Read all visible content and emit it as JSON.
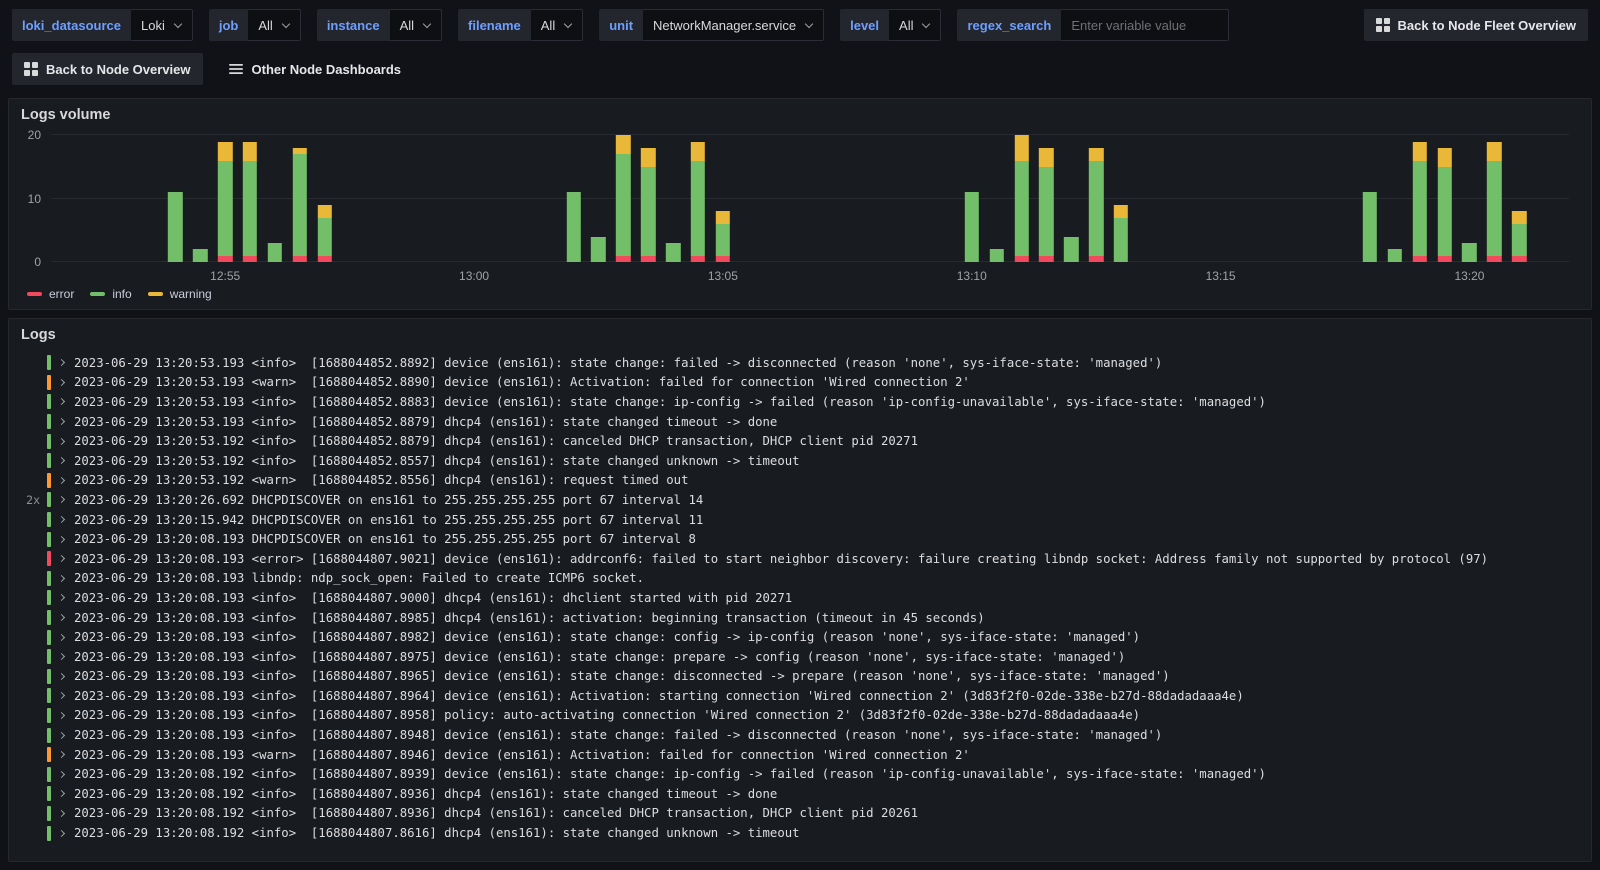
{
  "toolbar": {
    "variables": [
      {
        "label": "loki_datasource",
        "type": "select",
        "value": "Loki"
      },
      {
        "label": "job",
        "type": "select",
        "value": "All"
      },
      {
        "label": "instance",
        "type": "select",
        "value": "All"
      },
      {
        "label": "filename",
        "type": "select",
        "value": "All"
      },
      {
        "label": "unit",
        "type": "select",
        "value": "NetworkManager.service"
      },
      {
        "label": "level",
        "type": "select",
        "value": "All"
      },
      {
        "label": "regex_search",
        "type": "input",
        "placeholder": "Enter variable value"
      }
    ],
    "fleet_button": {
      "label": "Back to Node Fleet Overview"
    }
  },
  "nav": {
    "back_button": {
      "label": "Back to Node Overview"
    },
    "other_dashboards": {
      "label": "Other Node Dashboards"
    }
  },
  "chart_data": {
    "type": "bar",
    "stacked": true,
    "title": "Logs volume",
    "x_axis": {
      "start": "12:51:30",
      "end": "13:22:00",
      "tick_labels": [
        "12:55",
        "13:00",
        "13:05",
        "13:10",
        "13:15",
        "13:20"
      ]
    },
    "y_axis": {
      "tick_labels": [
        0,
        10,
        20
      ],
      "max": 21
    },
    "legend_position": "bottom",
    "legend": [
      {
        "label": "error",
        "color": "#f2495c"
      },
      {
        "label": "info",
        "color": "#73bf69"
      },
      {
        "label": "warning",
        "color": "#eab839"
      }
    ],
    "bars": [
      {
        "t": "12:54:00",
        "error": 0,
        "info": 11,
        "warning": 0
      },
      {
        "t": "12:54:30",
        "error": 0,
        "info": 2,
        "warning": 0
      },
      {
        "t": "12:55:00",
        "error": 1,
        "info": 15,
        "warning": 3
      },
      {
        "t": "12:55:30",
        "error": 1,
        "info": 15,
        "warning": 3
      },
      {
        "t": "12:56:00",
        "error": 0,
        "info": 3,
        "warning": 0
      },
      {
        "t": "12:56:30",
        "error": 1,
        "info": 16,
        "warning": 1
      },
      {
        "t": "12:57:00",
        "error": 1,
        "info": 6,
        "warning": 2
      },
      {
        "t": "13:02:00",
        "error": 0,
        "info": 11,
        "warning": 0
      },
      {
        "t": "13:02:30",
        "error": 0,
        "info": 4,
        "warning": 0
      },
      {
        "t": "13:03:00",
        "error": 1,
        "info": 16,
        "warning": 3
      },
      {
        "t": "13:03:30",
        "error": 1,
        "info": 14,
        "warning": 3
      },
      {
        "t": "13:04:00",
        "error": 0,
        "info": 3,
        "warning": 0
      },
      {
        "t": "13:04:30",
        "error": 1,
        "info": 15,
        "warning": 3
      },
      {
        "t": "13:05:00",
        "error": 1,
        "info": 5,
        "warning": 2
      },
      {
        "t": "13:10:00",
        "error": 0,
        "info": 11,
        "warning": 0
      },
      {
        "t": "13:10:30",
        "error": 0,
        "info": 2,
        "warning": 0
      },
      {
        "t": "13:11:00",
        "error": 1,
        "info": 15,
        "warning": 4
      },
      {
        "t": "13:11:30",
        "error": 1,
        "info": 14,
        "warning": 3
      },
      {
        "t": "13:12:00",
        "error": 0,
        "info": 4,
        "warning": 0
      },
      {
        "t": "13:12:30",
        "error": 1,
        "info": 15,
        "warning": 2
      },
      {
        "t": "13:13:00",
        "error": 0,
        "info": 7,
        "warning": 2
      },
      {
        "t": "13:18:00",
        "error": 0,
        "info": 11,
        "warning": 0
      },
      {
        "t": "13:18:30",
        "error": 0,
        "info": 2,
        "warning": 0
      },
      {
        "t": "13:19:00",
        "error": 1,
        "info": 15,
        "warning": 3
      },
      {
        "t": "13:19:30",
        "error": 1,
        "info": 14,
        "warning": 3
      },
      {
        "t": "13:20:00",
        "error": 0,
        "info": 3,
        "warning": 0
      },
      {
        "t": "13:20:30",
        "error": 1,
        "info": 15,
        "warning": 3
      },
      {
        "t": "13:21:00",
        "error": 1,
        "info": 5,
        "warning": 2
      }
    ]
  },
  "logs": {
    "title": "Logs",
    "level_colors": {
      "info": "#73bf69",
      "warn": "#ff9830",
      "error": "#f2495c"
    },
    "lines": [
      {
        "count": "",
        "level": "info",
        "text": "2023-06-29 13:20:53.193 <info>  [1688044852.8892] device (ens161): state change: failed -> disconnected (reason 'none', sys-iface-state: 'managed')"
      },
      {
        "count": "",
        "level": "warn",
        "text": "2023-06-29 13:20:53.193 <warn>  [1688044852.8890] device (ens161): Activation: failed for connection 'Wired connection 2'"
      },
      {
        "count": "",
        "level": "info",
        "text": "2023-06-29 13:20:53.193 <info>  [1688044852.8883] device (ens161): state change: ip-config -> failed (reason 'ip-config-unavailable', sys-iface-state: 'managed')"
      },
      {
        "count": "",
        "level": "info",
        "text": "2023-06-29 13:20:53.193 <info>  [1688044852.8879] dhcp4 (ens161): state changed timeout -> done"
      },
      {
        "count": "",
        "level": "info",
        "text": "2023-06-29 13:20:53.192 <info>  [1688044852.8879] dhcp4 (ens161): canceled DHCP transaction, DHCP client pid 20271"
      },
      {
        "count": "",
        "level": "info",
        "text": "2023-06-29 13:20:53.192 <info>  [1688044852.8557] dhcp4 (ens161): state changed unknown -> timeout"
      },
      {
        "count": "",
        "level": "warn",
        "text": "2023-06-29 13:20:53.192 <warn>  [1688044852.8556] dhcp4 (ens161): request timed out"
      },
      {
        "count": "2x",
        "level": "info",
        "text": "2023-06-29 13:20:26.692 DHCPDISCOVER on ens161 to 255.255.255.255 port 67 interval 14"
      },
      {
        "count": "",
        "level": "info",
        "text": "2023-06-29 13:20:15.942 DHCPDISCOVER on ens161 to 255.255.255.255 port 67 interval 11"
      },
      {
        "count": "",
        "level": "info",
        "text": "2023-06-29 13:20:08.193 DHCPDISCOVER on ens161 to 255.255.255.255 port 67 interval 8"
      },
      {
        "count": "",
        "level": "error",
        "text": "2023-06-29 13:20:08.193 <error> [1688044807.9021] device (ens161): addrconf6: failed to start neighbor discovery: failure creating libndp socket: Address family not supported by protocol (97)"
      },
      {
        "count": "",
        "level": "info",
        "text": "2023-06-29 13:20:08.193 libndp: ndp_sock_open: Failed to create ICMP6 socket."
      },
      {
        "count": "",
        "level": "info",
        "text": "2023-06-29 13:20:08.193 <info>  [1688044807.9000] dhcp4 (ens161): dhclient started with pid 20271"
      },
      {
        "count": "",
        "level": "info",
        "text": "2023-06-29 13:20:08.193 <info>  [1688044807.8985] dhcp4 (ens161): activation: beginning transaction (timeout in 45 seconds)"
      },
      {
        "count": "",
        "level": "info",
        "text": "2023-06-29 13:20:08.193 <info>  [1688044807.8982] device (ens161): state change: config -> ip-config (reason 'none', sys-iface-state: 'managed')"
      },
      {
        "count": "",
        "level": "info",
        "text": "2023-06-29 13:20:08.193 <info>  [1688044807.8975] device (ens161): state change: prepare -> config (reason 'none', sys-iface-state: 'managed')"
      },
      {
        "count": "",
        "level": "info",
        "text": "2023-06-29 13:20:08.193 <info>  [1688044807.8965] device (ens161): state change: disconnected -> prepare (reason 'none', sys-iface-state: 'managed')"
      },
      {
        "count": "",
        "level": "info",
        "text": "2023-06-29 13:20:08.193 <info>  [1688044807.8964] device (ens161): Activation: starting connection 'Wired connection 2' (3d83f2f0-02de-338e-b27d-88dadadaaa4e)"
      },
      {
        "count": "",
        "level": "info",
        "text": "2023-06-29 13:20:08.193 <info>  [1688044807.8958] policy: auto-activating connection 'Wired connection 2' (3d83f2f0-02de-338e-b27d-88dadadaaa4e)"
      },
      {
        "count": "",
        "level": "info",
        "text": "2023-06-29 13:20:08.193 <info>  [1688044807.8948] device (ens161): state change: failed -> disconnected (reason 'none', sys-iface-state: 'managed')"
      },
      {
        "count": "",
        "level": "warn",
        "text": "2023-06-29 13:20:08.193 <warn>  [1688044807.8946] device (ens161): Activation: failed for connection 'Wired connection 2'"
      },
      {
        "count": "",
        "level": "info",
        "text": "2023-06-29 13:20:08.192 <info>  [1688044807.8939] device (ens161): state change: ip-config -> failed (reason 'ip-config-unavailable', sys-iface-state: 'managed')"
      },
      {
        "count": "",
        "level": "info",
        "text": "2023-06-29 13:20:08.192 <info>  [1688044807.8936] dhcp4 (ens161): state changed timeout -> done"
      },
      {
        "count": "",
        "level": "info",
        "text": "2023-06-29 13:20:08.192 <info>  [1688044807.8936] dhcp4 (ens161): canceled DHCP transaction, DHCP client pid 20261"
      },
      {
        "count": "",
        "level": "info",
        "text": "2023-06-29 13:20:08.192 <info>  [1688044807.8616] dhcp4 (ens161): state changed unknown -> timeout"
      }
    ]
  }
}
